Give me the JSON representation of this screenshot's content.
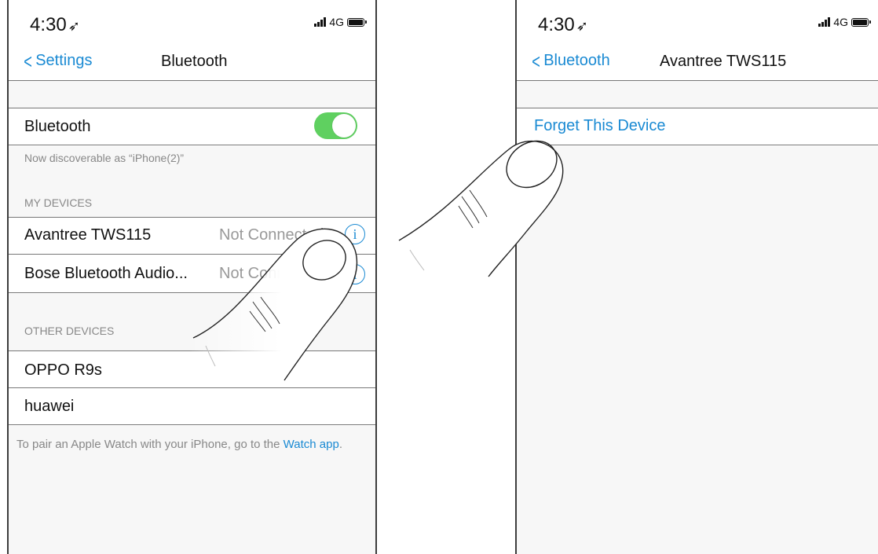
{
  "left_screen": {
    "status": {
      "time": "4:30",
      "network": "4G"
    },
    "nav": {
      "back_label": "Settings",
      "title": "Bluetooth"
    },
    "bluetooth_row": {
      "label": "Bluetooth",
      "enabled": true
    },
    "discoverable_text": "Now discoverable as “iPhone(2)”",
    "my_devices": {
      "header": "MY DEVICES",
      "items": [
        {
          "name": "Avantree TWS115",
          "status": "Not Connected"
        },
        {
          "name": "Bose Bluetooth Audio...",
          "status": "Not Connected"
        }
      ]
    },
    "other_devices": {
      "header": "OTHER DEVICES",
      "items": [
        {
          "name": "OPPO R9s"
        },
        {
          "name": "huawei"
        }
      ]
    },
    "footer": {
      "text": "To pair an Apple Watch with your iPhone, go to the ",
      "link": "Watch app",
      "end": "."
    }
  },
  "right_screen": {
    "status": {
      "time": "4:30",
      "network": "4G"
    },
    "nav": {
      "back_label": "Bluetooth",
      "title": "Avantree TWS115"
    },
    "forget_label": "Forget This Device"
  },
  "colors": {
    "accent_blue": "#1a8ad3",
    "toggle_green": "#5fd060",
    "secondary_text": "#888888",
    "group_background": "#f7f7f7"
  }
}
